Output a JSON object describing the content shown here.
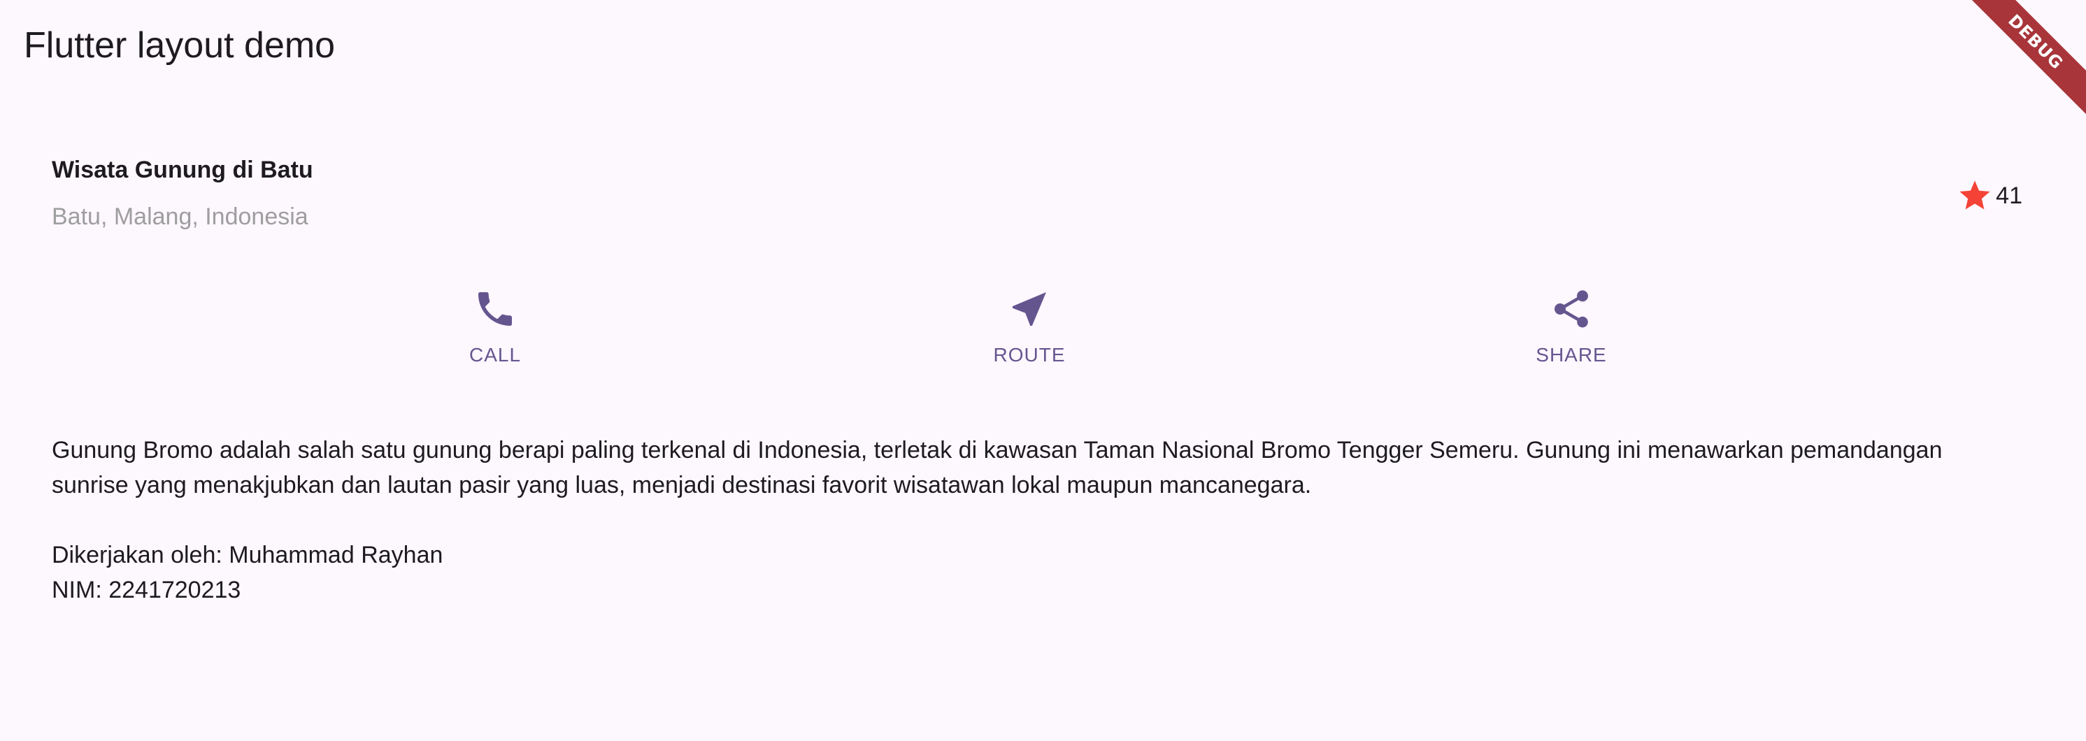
{
  "app_bar": {
    "title": "Flutter layout demo"
  },
  "debug_banner": {
    "label": "DEBUG",
    "color": "#a8353a"
  },
  "title_section": {
    "name": "Wisata Gunung di Batu",
    "location": "Batu, Malang, Indonesia",
    "rating": {
      "icon": "star-icon",
      "count": "41",
      "star_color": "#f44336"
    }
  },
  "buttons": [
    {
      "icon": "phone-icon",
      "label": "CALL"
    },
    {
      "icon": "navigation-icon",
      "label": "ROUTE"
    },
    {
      "icon": "share-icon",
      "label": "SHARE"
    }
  ],
  "text_section": {
    "description": "Gunung Bromo adalah salah satu gunung berapi paling terkenal di Indonesia, terletak di kawasan Taman Nasional Bromo Tengger Semeru. Gunung ini menawarkan pemandangan sunrise yang menakjubkan dan lautan pasir yang luas, menjadi destinasi favorit wisatawan lokal maupun mancanegara.",
    "credit_line_1": "Dikerjakan oleh: Muhammad Rayhan",
    "credit_line_2": "NIM: 2241720213"
  },
  "colors": {
    "background": "#fdf7fe",
    "accent": "#65558f",
    "text": "#1d1b20",
    "muted_text": "#9e9e9e"
  }
}
